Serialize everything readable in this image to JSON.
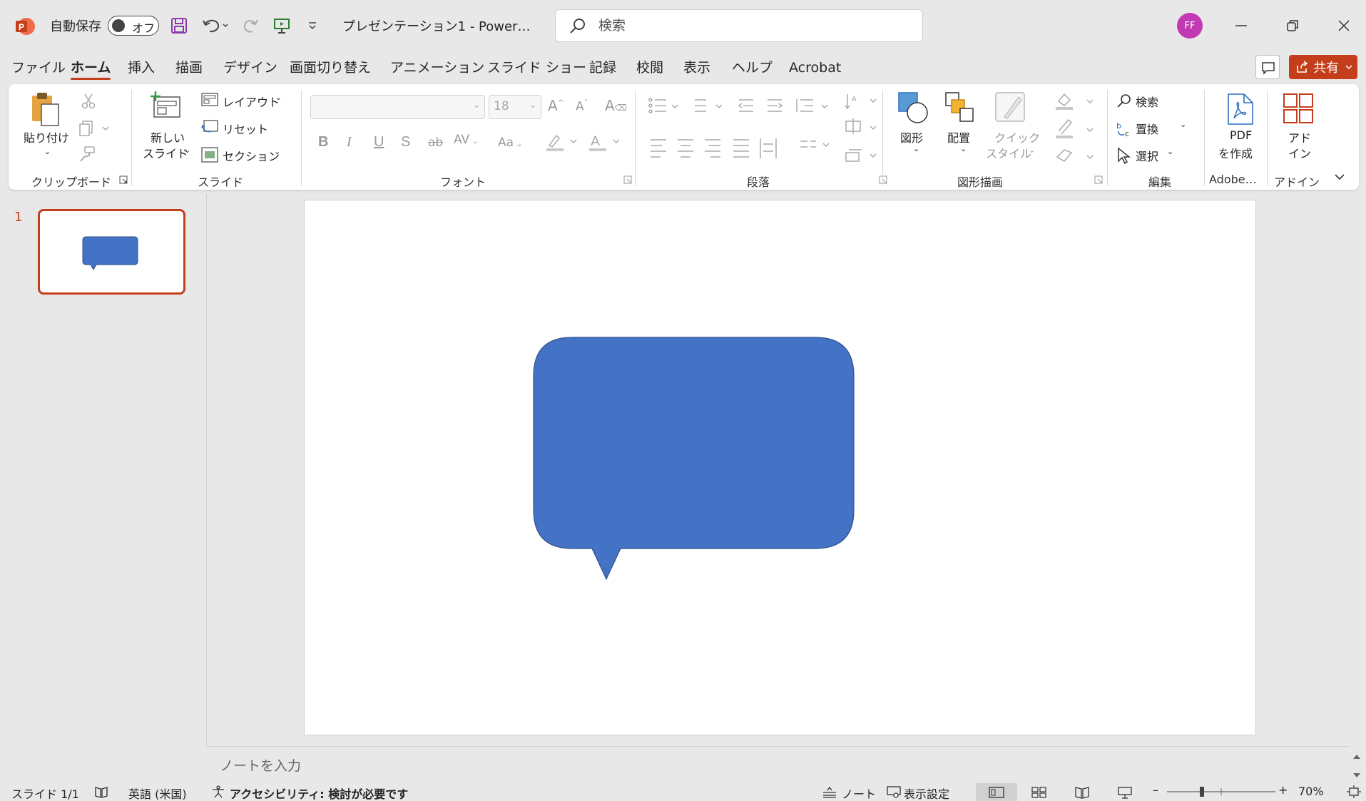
{
  "titlebar": {
    "autosave_label": "自動保存",
    "autosave_state": "オフ",
    "document_title": "プレゼンテーション1  -  Power…",
    "search_placeholder": "検索",
    "avatar_initials": "FF"
  },
  "tabs": [
    "ファイル",
    "ホーム",
    "挿入",
    "描画",
    "デザイン",
    "画面切り替え",
    "アニメーション",
    "スライド ショー",
    "記録",
    "校閲",
    "表示",
    "ヘルプ",
    "Acrobat"
  ],
  "active_tab": "ホーム",
  "share_label": "共有",
  "ribbon": {
    "clipboard": {
      "label": "クリップボード",
      "paste": "貼り付け"
    },
    "slides": {
      "label": "スライド",
      "new_slide_line1": "新しい",
      "new_slide_line2": "スライド",
      "layout": "レイアウト",
      "reset": "リセット",
      "section": "セクション"
    },
    "font": {
      "label": "フォント",
      "font_size": "18"
    },
    "paragraph": {
      "label": "段落"
    },
    "drawing": {
      "label": "図形描画",
      "shapes": "図形",
      "arrange": "配置",
      "quick_style_line1": "クイック",
      "quick_style_line2": "スタイル"
    },
    "editing": {
      "label": "編集",
      "find": "検索",
      "replace": "置換",
      "select": "選択"
    },
    "adobe": {
      "label": "Adobe…",
      "pdf_line1": "PDF",
      "pdf_line2": "を作成"
    },
    "addins": {
      "label": "アドイン",
      "line1": "アド",
      "line2": "イン"
    }
  },
  "slide_panel": {
    "slide_number": "1"
  },
  "notes_placeholder": "ノートを入力",
  "statusbar": {
    "slide_info": "スライド 1/1",
    "language": "英語 (米国)",
    "accessibility": "アクセシビリティ: 検討が必要です",
    "notes": "ノート",
    "display_settings": "表示設定",
    "zoom": "70%"
  },
  "colors": {
    "accent": "#c43e1c",
    "shape_fill": "#4472c4",
    "shape_stroke": "#2f528f"
  }
}
